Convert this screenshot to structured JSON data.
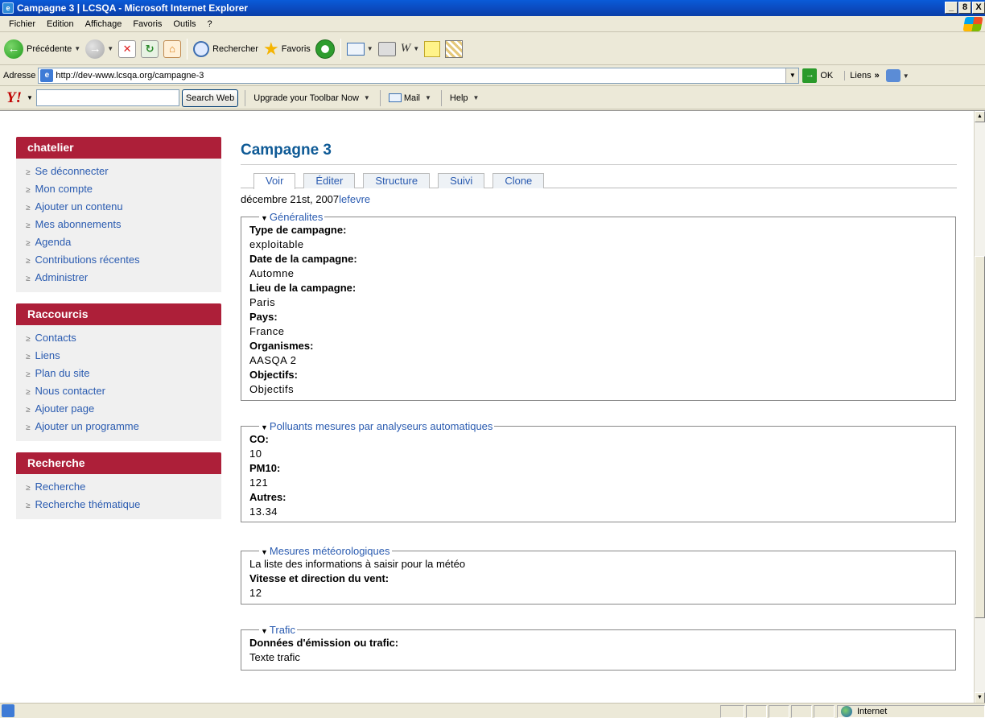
{
  "window": {
    "title": "Campagne 3 | LCSQA - Microsoft Internet Explorer",
    "buttons": [
      "_",
      "8",
      "X"
    ]
  },
  "menu": {
    "items": [
      "Fichier",
      "Edition",
      "Affichage",
      "Favoris",
      "Outils",
      "?"
    ]
  },
  "toolbar": {
    "back_label": "Précédente",
    "search_label": "Rechercher",
    "favorites_label": "Favoris"
  },
  "address": {
    "label": "Adresse",
    "url": "http://dev-www.lcsqa.org/campagne-3",
    "go_label": "OK",
    "links_label": "Liens",
    "links_chevron": "»"
  },
  "yahoo": {
    "logo": "Y!",
    "search_button": "Search Web",
    "upgrade_label": "Upgrade your Toolbar Now",
    "mail_label": "Mail",
    "help_label": "Help"
  },
  "sidebar": {
    "user_block": {
      "title": "chatelier",
      "items": [
        "Se déconnecter",
        "Mon compte",
        "Ajouter un contenu",
        "Mes abonnements",
        "Agenda",
        "Contributions récentes",
        "Administrer"
      ]
    },
    "shortcuts_block": {
      "title": "Raccourcis",
      "items": [
        "Contacts",
        "Liens",
        "Plan du site",
        "Nous contacter",
        "Ajouter page",
        "Ajouter un programme"
      ]
    },
    "search_block": {
      "title": "Recherche",
      "items": [
        "Recherche",
        "Recherche thématique"
      ]
    }
  },
  "main": {
    "title": "Campagne 3",
    "tabs": [
      "Voir",
      "Éditer",
      "Structure",
      "Suivi",
      "Clone"
    ],
    "date": "décembre 21st, 2007",
    "author": "lefevre",
    "sections": {
      "generalites": {
        "legend": "Généralites",
        "fields": [
          {
            "label": "Type de campagne:",
            "value": "exploitable"
          },
          {
            "label": "Date de la campagne:",
            "value": "Automne"
          },
          {
            "label": "Lieu de la campagne:",
            "value": "Paris"
          },
          {
            "label": "Pays:",
            "value": "France"
          },
          {
            "label": "Organismes:",
            "value": "AASQA 2"
          },
          {
            "label": "Objectifs:",
            "value": "Objectifs"
          }
        ]
      },
      "polluants": {
        "legend": "Polluants mesures par analyseurs automatiques",
        "fields": [
          {
            "label": "CO:",
            "value": "10"
          },
          {
            "label": "PM10:",
            "value": "121"
          },
          {
            "label": "Autres:",
            "value": "13.34"
          }
        ]
      },
      "meteo": {
        "legend": "Mesures météorologiques",
        "intro": "La liste des informations à saisir pour la météo",
        "fields": [
          {
            "label": "Vitesse et direction du vent:",
            "value": "12"
          }
        ]
      },
      "trafic": {
        "legend": "Trafic",
        "fields": [
          {
            "label": "Données d'émission ou trafic:",
            "value": "Texte trafic"
          }
        ]
      }
    }
  },
  "status": {
    "zone": "Internet"
  }
}
